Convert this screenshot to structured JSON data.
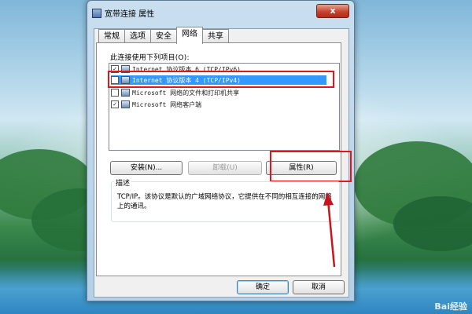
{
  "window": {
    "title": "宽带连接 属性",
    "close_label": "x"
  },
  "tabs": [
    {
      "label": "常规"
    },
    {
      "label": "选项"
    },
    {
      "label": "安全"
    },
    {
      "label": "网络",
      "active": true
    },
    {
      "label": "共享"
    }
  ],
  "network": {
    "list_label": "此连接使用下列项目(O):",
    "items": [
      {
        "label": "Internet 协议版本 6 (TCP/IPv6)",
        "checked": true
      },
      {
        "label": "Internet 协议版本 4 (TCP/IPv4)",
        "checked": true,
        "selected": true
      },
      {
        "label": "Microsoft 网络的文件和打印机共享",
        "checked": false
      },
      {
        "label": "Microsoft 网络客户端",
        "checked": true
      }
    ],
    "install_label": "安装(N)...",
    "uninstall_label": "卸载(U)",
    "properties_label": "属性(R)",
    "description_title": "描述",
    "description": "TCP/IP。该协议是默认的广域网络协议，它提供在不同的相互连接的网络上的通讯。"
  },
  "footer": {
    "ok_label": "确定",
    "cancel_label": "取消"
  },
  "watermark": "Bai经验",
  "colors": {
    "highlight_box": "#e0161a",
    "selection": "#3399ff",
    "arrow": "#c8141c"
  }
}
